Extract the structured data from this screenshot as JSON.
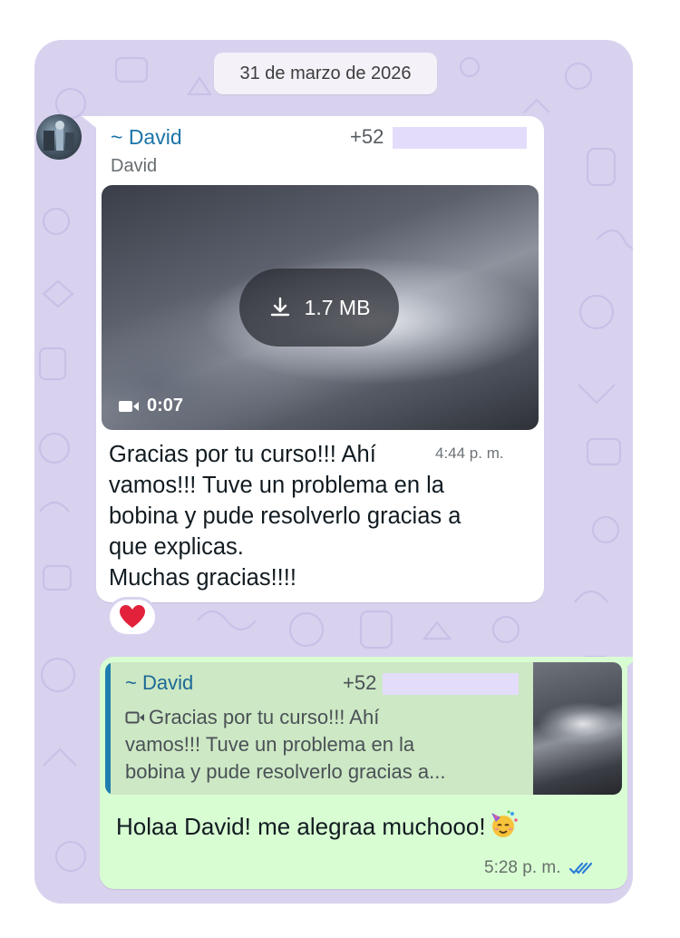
{
  "chat": {
    "date_divider": "31 de marzo de 2026",
    "colors": {
      "wallpaper": "#d9d2ef",
      "incoming_bubble": "#ffffff",
      "outgoing_bubble": "#d9fdd3",
      "sender_name": "#1b74a8",
      "read_ticks": "#2d7fd6",
      "reaction_heart": "#e2213a"
    }
  },
  "incoming_message": {
    "sender_name": "~ David",
    "sender_phone": "+52",
    "sender_subtitle": "David",
    "avatar_icon": "profile-photo",
    "video": {
      "download_icon": "download-icon",
      "size": "1.7 MB",
      "duration_icon": "video-camera-icon",
      "duration": "0:07"
    },
    "text_lines": [
      "Gracias por tu curso!!! Ahí",
      "vamos!!! Tuve un problema en la",
      "bobina y pude resolverlo gracias a",
      "que explicas.",
      "Muchas gracias!!!!"
    ],
    "time": "4:44 p. m.",
    "reaction": "heart"
  },
  "outgoing_message": {
    "quote": {
      "name": "~ David",
      "phone": "+52",
      "icon": "video-camera-icon",
      "text_lines": [
        "Gracias por tu curso!!! Ahí",
        "vamos!!! Tuve un problema en la",
        "bobina y pude resolverlo gracias a..."
      ]
    },
    "text": "Holaa David! me alegraa muchooo!",
    "emoji": "partying-face",
    "time": "5:28 p. m.",
    "status_icon": "double-check-read"
  }
}
